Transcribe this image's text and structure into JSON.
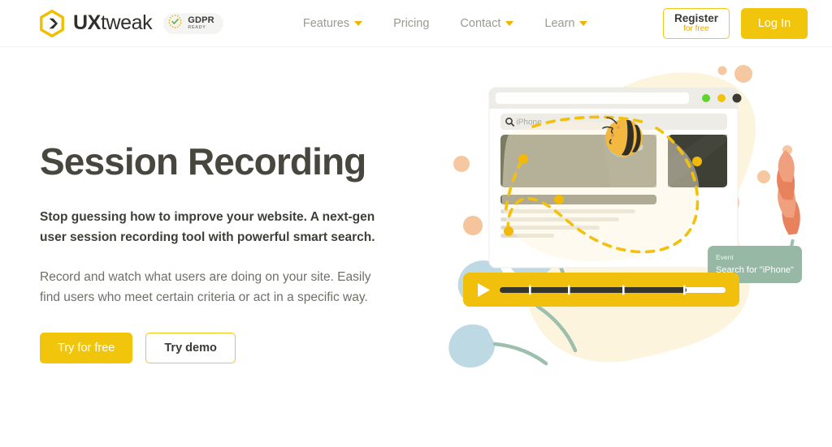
{
  "brand": {
    "logo_icon": "hexagon-chevron-logo",
    "name_bold": "UX",
    "name_light": "tweak",
    "badge": {
      "icon": "dotted-check-circle",
      "line1": "GDPR",
      "line2": "READY"
    }
  },
  "nav": {
    "items": [
      {
        "label": "Features",
        "has_dropdown": true
      },
      {
        "label": "Pricing",
        "has_dropdown": false
      },
      {
        "label": "Contact",
        "has_dropdown": true
      },
      {
        "label": "Learn",
        "has_dropdown": true
      }
    ]
  },
  "auth": {
    "register_label": "Register",
    "register_sub": "for free",
    "login_label": "Log In"
  },
  "hero": {
    "title": "Session Recording",
    "subtitle": "Stop guessing how to improve your website. A next-gen user session recording tool with powerful smart search.",
    "description": "Record and watch what users are doing on your site. Easily find users who meet certain criteria or act in a specific way.",
    "cta_primary": "Try for free",
    "cta_secondary": "Try demo"
  },
  "illustration": {
    "browser": {
      "url_placeholder": "",
      "dots": [
        "#5fd32e",
        "#f2c20d",
        "#3b3b33"
      ],
      "search_icon": "magnifier-icon",
      "search_value": "iPhone"
    },
    "tooltip": {
      "label": "Event",
      "text": "Search for \"iPhone\""
    },
    "player": {
      "play_icon": "play-triangle-icon",
      "progress_percent": 83
    },
    "bee_icon": "bee-icon"
  },
  "colors": {
    "brand_yellow": "#f2c50d",
    "logo_yellow": "#f0bf00",
    "heading": "#47473f",
    "body_text": "#6f6f6a",
    "nav_text": "#9a9a94",
    "olive": "#7b7b63",
    "dark_olive": "#3f4035",
    "sage": "#96b8a5",
    "coral": "#e8825c",
    "sky": "#bcd9e4",
    "peach": "#f5c49a",
    "cream": "#fdf4dd"
  }
}
